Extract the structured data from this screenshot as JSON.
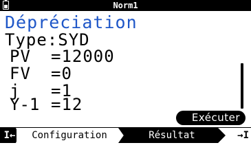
{
  "status_bar": {
    "mode": "Norm1",
    "battery_icon": "battery-icon"
  },
  "title": "Dépréciation",
  "type_line": "Type:SYD",
  "fields": [
    {
      "label": "PV",
      "eq": "=",
      "value": "12000"
    },
    {
      "label": "FV",
      "eq": "=",
      "value": "0"
    },
    {
      "label": "j",
      "eq": "=",
      "value": "1"
    },
    {
      "label": "Y-1",
      "eq": "=",
      "value": "12"
    }
  ],
  "execute_button": "Exécuter",
  "softkeys": {
    "prev_icon": "I←",
    "configuration": "Configuration",
    "result": "Résultat",
    "next_icon": "→I"
  },
  "colors": {
    "title": "#1f57c8",
    "bar": "#000000",
    "background": "#ffffff"
  }
}
